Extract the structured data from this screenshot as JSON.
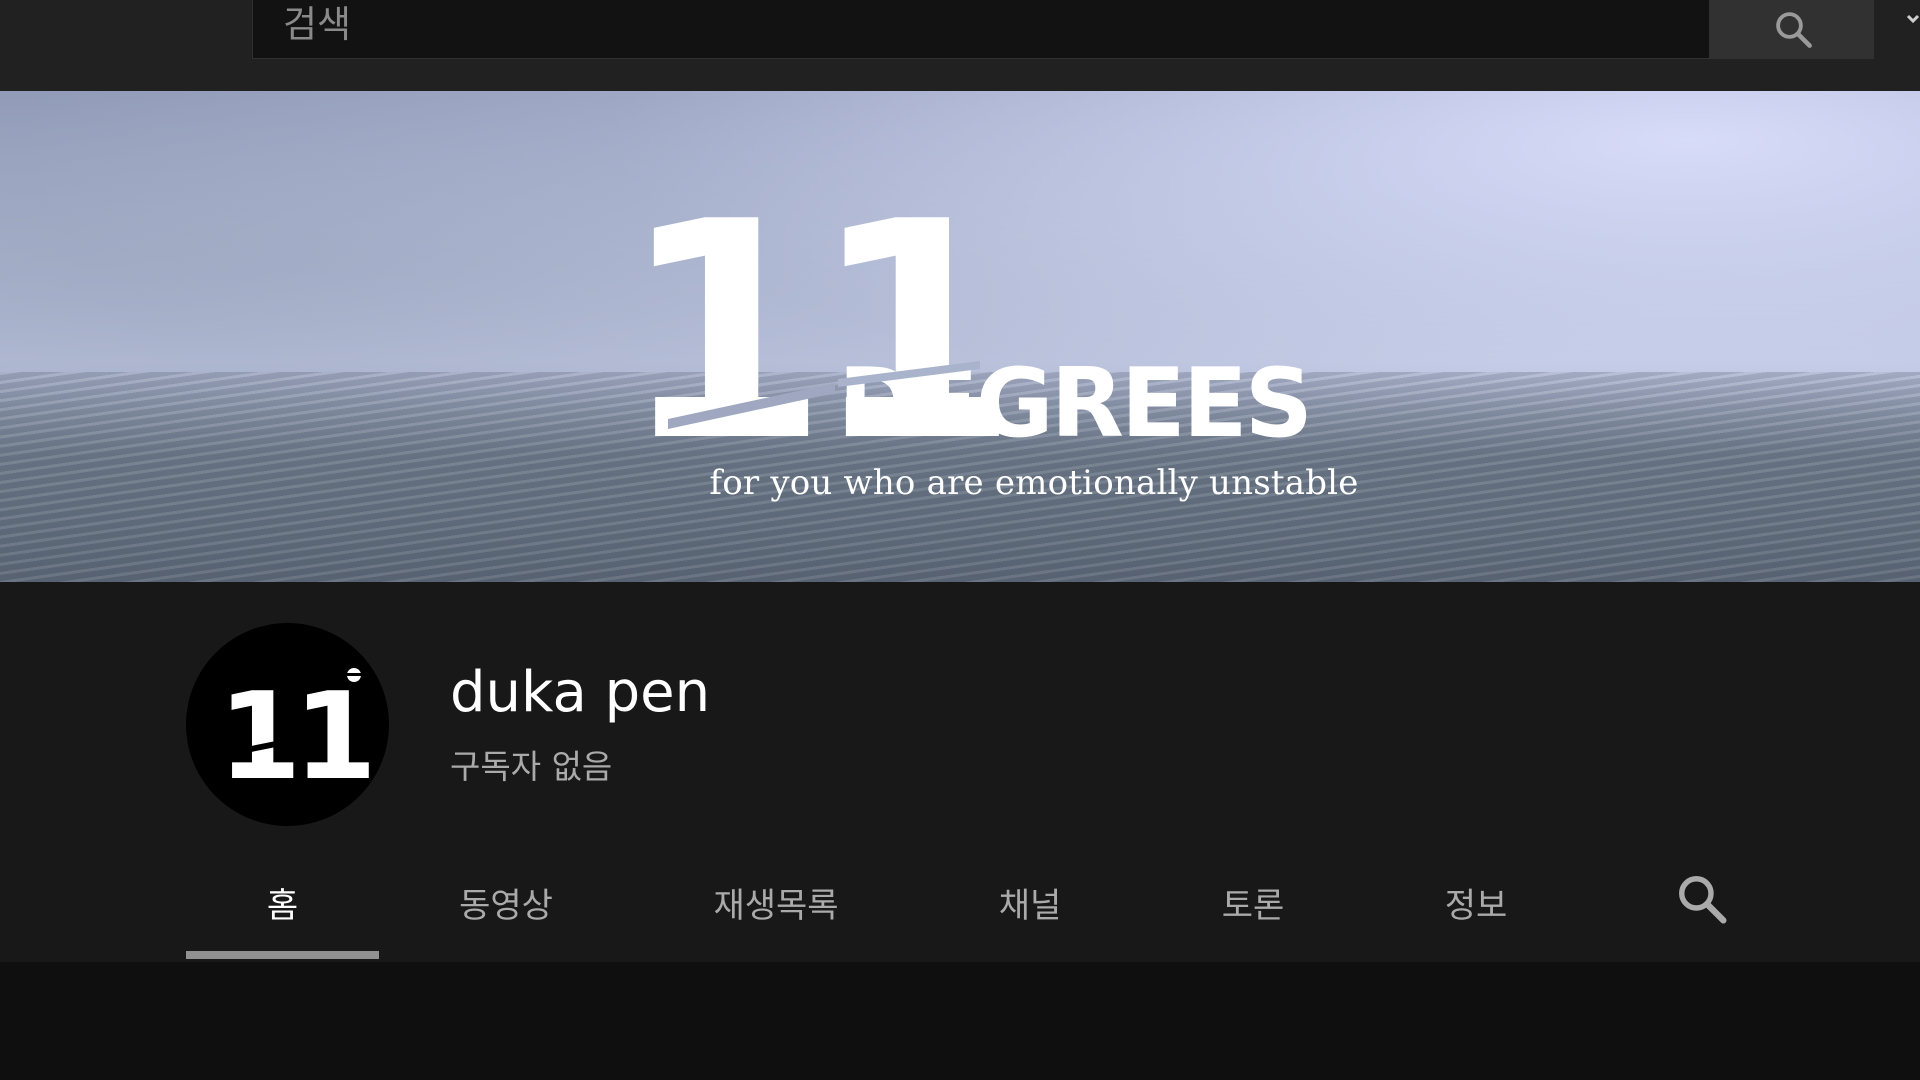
{
  "search": {
    "placeholder": "검색"
  },
  "banner": {
    "number": "11",
    "word": "DEGREES",
    "tagline": "for you who are emotionally unstable"
  },
  "channel": {
    "avatar_text": "11",
    "name": "duka pen",
    "subscribers": "구독자 없음"
  },
  "tabs": [
    {
      "label": "홈",
      "active": true
    },
    {
      "label": "동영상",
      "active": false
    },
    {
      "label": "재생목록",
      "active": false
    },
    {
      "label": "채널",
      "active": false
    },
    {
      "label": "토론",
      "active": false
    },
    {
      "label": "정보",
      "active": false
    }
  ],
  "icons": {
    "search_button": "search-icon",
    "tab_search": "search-icon",
    "top_right": "chevron-down-icon"
  },
  "colors": {
    "background": "#0f0f0f",
    "header": "#181818",
    "topbar": "#212121",
    "active_tab": "#ffffff",
    "inactive_tab": "#aaaaaa",
    "underline": "#909090"
  }
}
